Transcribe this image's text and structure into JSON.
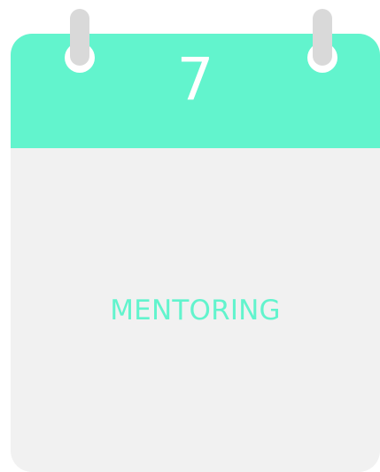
{
  "calendar": {
    "day": "7",
    "label": "MENTORING"
  },
  "colors": {
    "accent": "#62f4cd",
    "page": "#f1f1f1",
    "pin": "#d9d9d9",
    "ring": "#ffffff",
    "number": "#ffffff"
  },
  "icons": {
    "left_binding": "calendar-ring-icon",
    "right_binding": "calendar-ring-icon"
  }
}
